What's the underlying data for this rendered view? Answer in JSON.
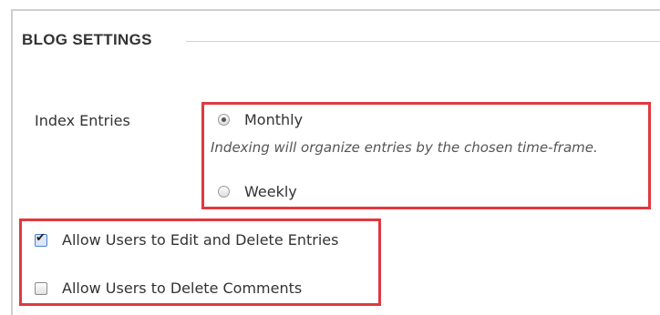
{
  "section": {
    "title": "BLOG SETTINGS"
  },
  "index_entries": {
    "label": "Index Entries",
    "options": [
      {
        "label": "Monthly",
        "selected": true
      },
      {
        "label": "Weekly",
        "selected": false
      }
    ],
    "help_text": "Indexing will organize entries by the chosen time-frame."
  },
  "permissions": {
    "items": [
      {
        "label": "Allow Users to Edit and Delete Entries",
        "checked": true
      },
      {
        "label": "Allow Users to Delete Comments",
        "checked": false
      }
    ]
  },
  "icons": {
    "checkmark": "✔"
  },
  "colors": {
    "highlight": "#e0393e",
    "checkbox_checked_fill": "#dbe7f8",
    "panel_border": "#cfcfcf"
  }
}
